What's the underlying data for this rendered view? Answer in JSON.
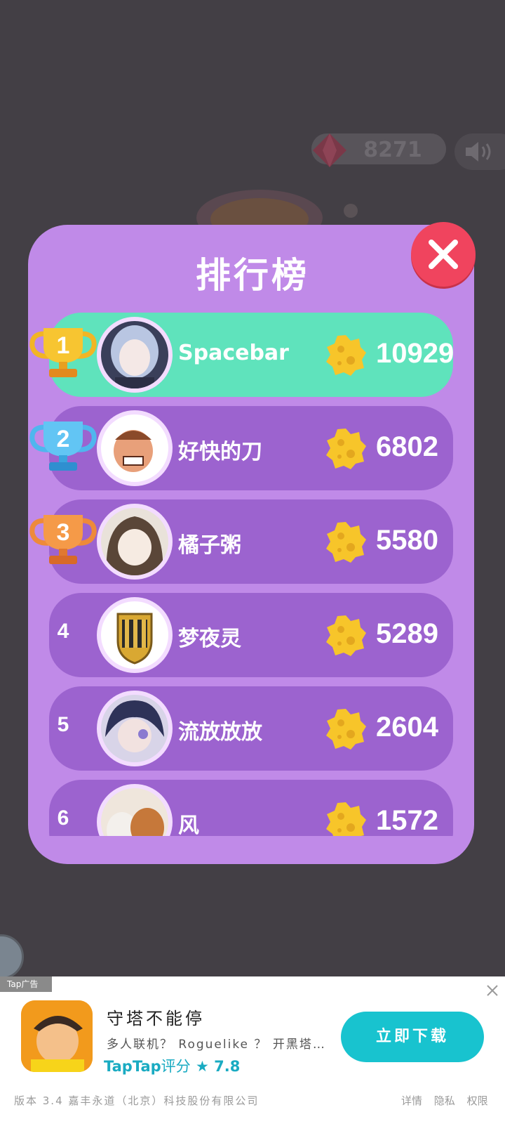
{
  "hud": {
    "gem_count": "8271"
  },
  "leaderboard": {
    "title": "排行榜",
    "entries": [
      {
        "rank": "1",
        "name": "Spacebar",
        "score": "10929",
        "is_me": true
      },
      {
        "rank": "2",
        "name": "好快的刀",
        "score": "6802"
      },
      {
        "rank": "3",
        "name": "橘子粥",
        "score": "5580"
      },
      {
        "rank": "4",
        "name": "梦夜灵",
        "score": "5289"
      },
      {
        "rank": "5",
        "name": "流放放放",
        "score": "2604"
      },
      {
        "rank": "6",
        "name": "风",
        "score": "1572"
      }
    ]
  },
  "ad": {
    "tag": "Tap广告",
    "app_name": "守塔不能停",
    "description": "多人联机？ Roguelike ？ 开黑塔防！",
    "rating_brand": "TapTap",
    "rating_label": "评分",
    "rating_value": "7.8",
    "cta": "立即下载",
    "footer": "版本 3.4  嘉丰永道（北京）科技股份有限公司",
    "links": [
      "详情",
      "隐私",
      "权限"
    ]
  },
  "colors": {
    "panel": "#c08ae8",
    "row": "#9c63cf",
    "row_me": "#5fe3bc",
    "close": "#f0445e",
    "cta": "#18c3cf"
  }
}
